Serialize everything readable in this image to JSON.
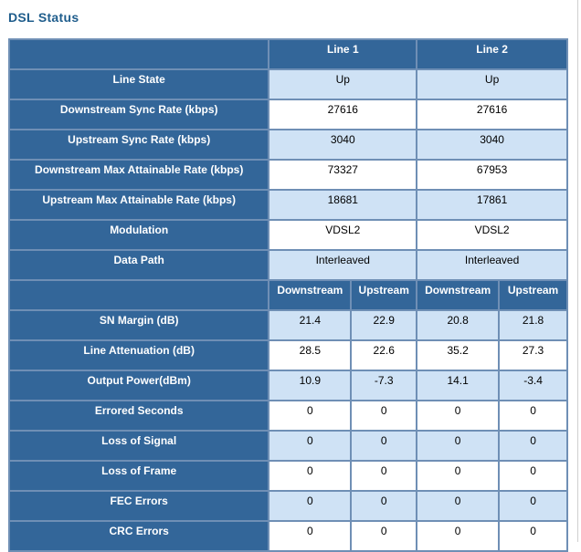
{
  "title": "DSL Status",
  "header": {
    "line1": "Line 1",
    "line2": "Line 2"
  },
  "line_rows": [
    {
      "label": "Line State",
      "l1": "Up",
      "l2": "Up"
    },
    {
      "label": "Downstream Sync Rate (kbps)",
      "l1": "27616",
      "l2": "27616"
    },
    {
      "label": "Upstream Sync Rate (kbps)",
      "l1": "3040",
      "l2": "3040"
    },
    {
      "label": "Downstream Max Attainable Rate (kbps)",
      "l1": "73327",
      "l2": "67953"
    },
    {
      "label": "Upstream Max Attainable Rate (kbps)",
      "l1": "18681",
      "l2": "17861"
    },
    {
      "label": "Modulation",
      "l1": "VDSL2",
      "l2": "VDSL2"
    },
    {
      "label": "Data Path",
      "l1": "Interleaved",
      "l2": "Interleaved"
    }
  ],
  "sub_header": [
    "Downstream",
    "Upstream",
    "Downstream",
    "Upstream"
  ],
  "stat_rows": [
    {
      "label": "SN Margin (dB)",
      "v": [
        "21.4",
        "22.9",
        "20.8",
        "21.8"
      ]
    },
    {
      "label": "Line Attenuation (dB)",
      "v": [
        "28.5",
        "22.6",
        "35.2",
        "27.3"
      ]
    },
    {
      "label": "Output Power(dBm)",
      "v": [
        "10.9",
        "-7.3",
        "14.1",
        "-3.4"
      ]
    },
    {
      "label": "Errored Seconds",
      "v": [
        "0",
        "0",
        "0",
        "0"
      ]
    },
    {
      "label": "Loss of Signal",
      "v": [
        "0",
        "0",
        "0",
        "0"
      ]
    },
    {
      "label": "Loss of Frame",
      "v": [
        "0",
        "0",
        "0",
        "0"
      ]
    },
    {
      "label": "FEC Errors",
      "v": [
        "0",
        "0",
        "0",
        "0"
      ]
    },
    {
      "label": "CRC Errors",
      "v": [
        "0",
        "0",
        "0",
        "0"
      ]
    }
  ]
}
